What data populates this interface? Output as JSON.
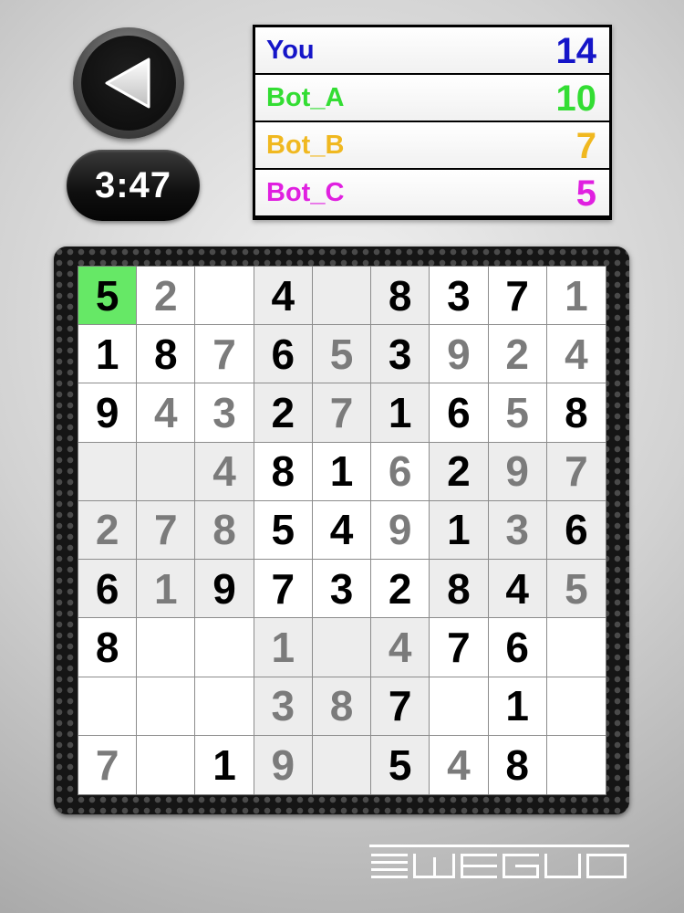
{
  "timer": "3:47",
  "scoreboard": [
    {
      "name": "You",
      "score": "14",
      "color": "#1515c8"
    },
    {
      "name": "Bot_A",
      "score": "10",
      "color": "#33dd33"
    },
    {
      "name": "Bot_B",
      "score": "7",
      "color": "#f0b820"
    },
    {
      "name": "Bot_C",
      "score": "5",
      "color": "#e020e0"
    }
  ],
  "board": [
    [
      {
        "v": "5",
        "t": "given"
      },
      {
        "v": "2",
        "t": "entered"
      },
      {
        "v": "",
        "t": ""
      },
      {
        "v": "4",
        "t": "given"
      },
      {
        "v": "",
        "t": ""
      },
      {
        "v": "8",
        "t": "given"
      },
      {
        "v": "3",
        "t": "given"
      },
      {
        "v": "7",
        "t": "given"
      },
      {
        "v": "1",
        "t": "entered"
      }
    ],
    [
      {
        "v": "1",
        "t": "given"
      },
      {
        "v": "8",
        "t": "given"
      },
      {
        "v": "7",
        "t": "entered"
      },
      {
        "v": "6",
        "t": "given"
      },
      {
        "v": "5",
        "t": "entered"
      },
      {
        "v": "3",
        "t": "given"
      },
      {
        "v": "9",
        "t": "entered"
      },
      {
        "v": "2",
        "t": "entered"
      },
      {
        "v": "4",
        "t": "entered"
      }
    ],
    [
      {
        "v": "9",
        "t": "given"
      },
      {
        "v": "4",
        "t": "entered"
      },
      {
        "v": "3",
        "t": "entered"
      },
      {
        "v": "2",
        "t": "given"
      },
      {
        "v": "7",
        "t": "entered"
      },
      {
        "v": "1",
        "t": "given"
      },
      {
        "v": "6",
        "t": "given"
      },
      {
        "v": "5",
        "t": "entered"
      },
      {
        "v": "8",
        "t": "given"
      }
    ],
    [
      {
        "v": "",
        "t": ""
      },
      {
        "v": "",
        "t": ""
      },
      {
        "v": "4",
        "t": "entered"
      },
      {
        "v": "8",
        "t": "given"
      },
      {
        "v": "1",
        "t": "given"
      },
      {
        "v": "6",
        "t": "entered"
      },
      {
        "v": "2",
        "t": "given"
      },
      {
        "v": "9",
        "t": "entered"
      },
      {
        "v": "7",
        "t": "entered"
      }
    ],
    [
      {
        "v": "2",
        "t": "entered"
      },
      {
        "v": "7",
        "t": "entered"
      },
      {
        "v": "8",
        "t": "entered"
      },
      {
        "v": "5",
        "t": "given"
      },
      {
        "v": "4",
        "t": "given"
      },
      {
        "v": "9",
        "t": "entered"
      },
      {
        "v": "1",
        "t": "given"
      },
      {
        "v": "3",
        "t": "entered"
      },
      {
        "v": "6",
        "t": "given"
      }
    ],
    [
      {
        "v": "6",
        "t": "given"
      },
      {
        "v": "1",
        "t": "entered"
      },
      {
        "v": "9",
        "t": "given"
      },
      {
        "v": "7",
        "t": "given"
      },
      {
        "v": "3",
        "t": "given"
      },
      {
        "v": "2",
        "t": "given"
      },
      {
        "v": "8",
        "t": "given"
      },
      {
        "v": "4",
        "t": "given"
      },
      {
        "v": "5",
        "t": "entered"
      }
    ],
    [
      {
        "v": "8",
        "t": "given"
      },
      {
        "v": "",
        "t": ""
      },
      {
        "v": "",
        "t": ""
      },
      {
        "v": "1",
        "t": "entered"
      },
      {
        "v": "",
        "t": ""
      },
      {
        "v": "4",
        "t": "entered"
      },
      {
        "v": "7",
        "t": "given"
      },
      {
        "v": "6",
        "t": "given"
      },
      {
        "v": "",
        "t": ""
      }
    ],
    [
      {
        "v": "",
        "t": ""
      },
      {
        "v": "",
        "t": ""
      },
      {
        "v": "",
        "t": ""
      },
      {
        "v": "3",
        "t": "entered"
      },
      {
        "v": "8",
        "t": "entered"
      },
      {
        "v": "7",
        "t": "given"
      },
      {
        "v": "",
        "t": ""
      },
      {
        "v": "1",
        "t": "given"
      },
      {
        "v": "",
        "t": ""
      }
    ],
    [
      {
        "v": "7",
        "t": "entered"
      },
      {
        "v": "",
        "t": ""
      },
      {
        "v": "1",
        "t": "given"
      },
      {
        "v": "9",
        "t": "entered"
      },
      {
        "v": "",
        "t": ""
      },
      {
        "v": "5",
        "t": "given"
      },
      {
        "v": "4",
        "t": "entered"
      },
      {
        "v": "8",
        "t": "given"
      },
      {
        "v": "",
        "t": ""
      }
    ]
  ],
  "selected_cell": {
    "row": 1,
    "col": 1
  },
  "colors": {
    "selected_cell": "#66e866",
    "given_digit": "#000000",
    "entered_digit": "#7b7b7b",
    "shaded_box": "#ededed"
  },
  "icons": {
    "back": "back-arrow-icon",
    "logo": "ewego-logo"
  },
  "logo_text": "EWEGUO"
}
